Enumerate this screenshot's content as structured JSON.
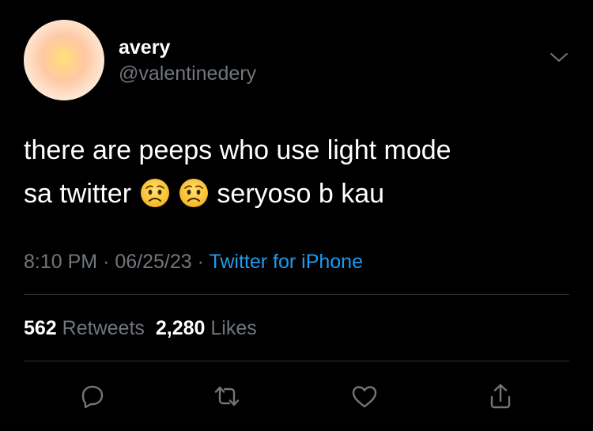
{
  "user": {
    "display_name": "avery",
    "handle": "@valentinedery",
    "avatar_colors": [
      "#ffe27a",
      "#ffc8a3",
      "#fff7ec"
    ]
  },
  "tweet": {
    "line1": "there are peeps who use light mode",
    "line2_start": "sa twitter",
    "emoji_name": "worried-face-emoji",
    "emoji_count": 2,
    "line2_end": "seryoso b kau"
  },
  "meta": {
    "time": "8:10 PM",
    "separator": "·",
    "date": "06/25/23",
    "source": "Twitter for iPhone"
  },
  "stats": {
    "retweets_count": "562",
    "retweets_label": "Retweets",
    "likes_count": "2,280",
    "likes_label": "Likes"
  },
  "actions": [
    {
      "name": "reply-icon"
    },
    {
      "name": "retweet-icon"
    },
    {
      "name": "like-icon"
    },
    {
      "name": "share-icon"
    }
  ],
  "colors": {
    "background": "#000000",
    "primary_text": "#ffffff",
    "secondary_text": "#71767b",
    "link": "#1d9bf0",
    "divider": "#2f3336"
  }
}
